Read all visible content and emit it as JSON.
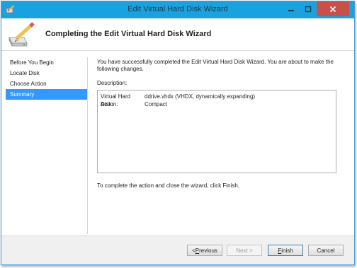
{
  "window": {
    "title": "Edit Virtual Hard Disk Wizard"
  },
  "header": {
    "title": "Completing the Edit Virtual Hard Disk Wizard",
    "icon": "disk-pencil-icon"
  },
  "steps": [
    {
      "label": "Before You Begin",
      "active": false
    },
    {
      "label": "Locate Disk",
      "active": false
    },
    {
      "label": "Choose Action",
      "active": false
    },
    {
      "label": "Summary",
      "active": true
    }
  ],
  "main": {
    "intro": "You have successfully completed the Edit Virtual Hard Disk Wizard. You are about to make the following changes.",
    "description_label": "Description:",
    "description_rows": [
      {
        "key": "Virtual Hard Disk:",
        "value": "ddrive.vhdx (VHDX, dynamically expanding)"
      },
      {
        "key": "Action:",
        "value": "Compact"
      }
    ],
    "finish_hint": "To complete the action and close the wizard, click Finish."
  },
  "buttons": {
    "previous": {
      "prefix": "< ",
      "mnemonic": "P",
      "rest": "revious",
      "enabled": true
    },
    "next": {
      "label": "Next >",
      "enabled": false
    },
    "finish": {
      "mnemonic": "F",
      "rest": "inish",
      "enabled": true
    },
    "cancel": {
      "label": "Cancel",
      "enabled": true
    }
  },
  "colors": {
    "titlebar": "#19a2de",
    "close": "#c7504b",
    "selection": "#3399ff"
  }
}
